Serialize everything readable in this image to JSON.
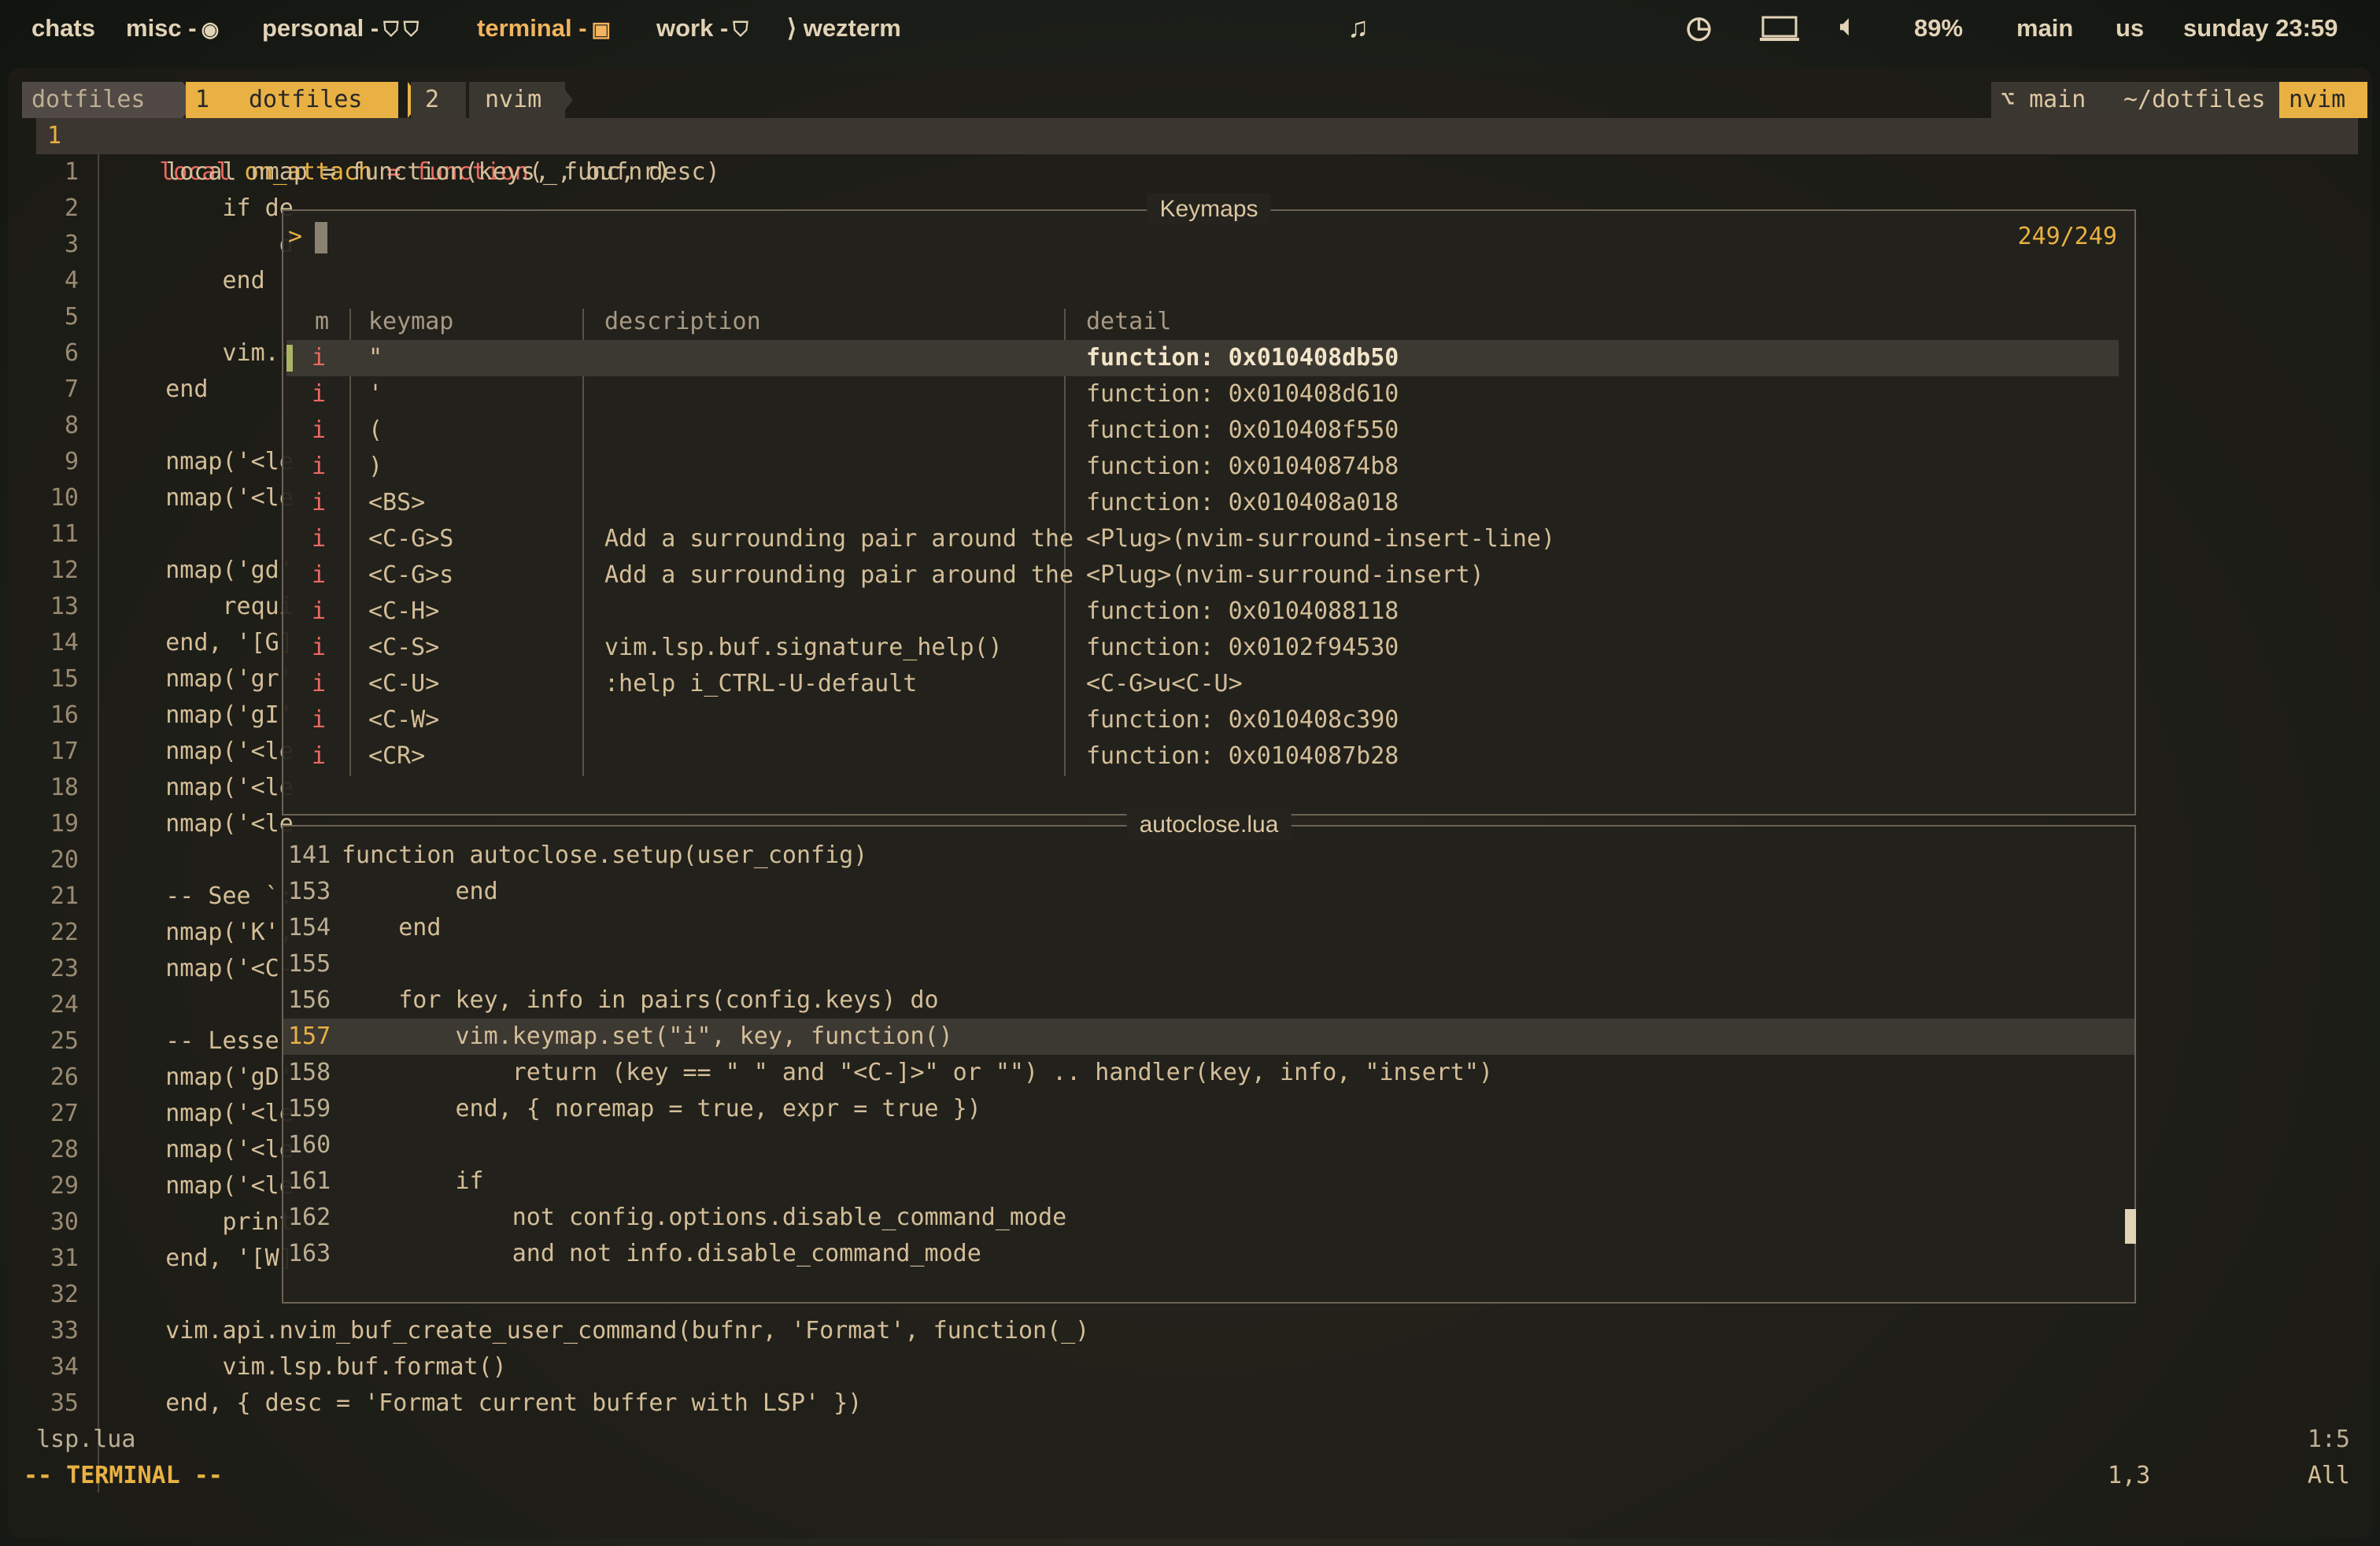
{
  "topbar": {
    "chats": "chats",
    "misc": "misc -",
    "personal": "personal -",
    "terminal": "terminal -",
    "work": "work -",
    "wezterm": "⟩ wezterm",
    "battery": "89%",
    "branch": "main",
    "lang": "us",
    "datetime": "sunday 23:59",
    "icons": [
      "music-note-icon",
      "clock-icon",
      "laptop-icon",
      "volume-icon"
    ]
  },
  "tabline": {
    "left": [
      {
        "label": "dotfiles"
      },
      {
        "label": "1"
      },
      {
        "label": "dotfiles"
      },
      {
        "label": "2"
      },
      {
        "label": "nvim"
      }
    ],
    "right": [
      {
        "label": "⌥ main"
      },
      {
        "label": "~/dotfiles"
      },
      {
        "label": "nvim"
      }
    ]
  },
  "first_line": {
    "num": "1",
    "text": "local on_attach = function(_, bufnr)"
  },
  "buffer_lines": [
    {
      "n": "1",
      "t": "    local nmap = function(keys, func, desc)"
    },
    {
      "n": "2",
      "t": "        if de"
    },
    {
      "n": "3",
      "t": "            d"
    },
    {
      "n": "4",
      "t": "        end"
    },
    {
      "n": "5",
      "t": ""
    },
    {
      "n": "6",
      "t": "        vim.k"
    },
    {
      "n": "7",
      "t": "    end"
    },
    {
      "n": "8",
      "t": ""
    },
    {
      "n": "9",
      "t": "    nmap('<le"
    },
    {
      "n": "10",
      "t": "    nmap('<le"
    },
    {
      "n": "11",
      "t": ""
    },
    {
      "n": "12",
      "t": "    nmap('gd'"
    },
    {
      "n": "13",
      "t": "        requi"
    },
    {
      "n": "14",
      "t": "    end, '[G]"
    },
    {
      "n": "15",
      "t": "    nmap('gr'"
    },
    {
      "n": "16",
      "t": "    nmap('gI'"
    },
    {
      "n": "17",
      "t": "    nmap('<le"
    },
    {
      "n": "18",
      "t": "    nmap('<le"
    },
    {
      "n": "19",
      "t": "    nmap('<le"
    },
    {
      "n": "20",
      "t": ""
    },
    {
      "n": "21",
      "t": "    -- See `:"
    },
    {
      "n": "22",
      "t": "    nmap('K',"
    },
    {
      "n": "23",
      "t": "    nmap('<C-"
    },
    {
      "n": "24",
      "t": ""
    },
    {
      "n": "25",
      "t": "    -- Lesser"
    },
    {
      "n": "26",
      "t": "    nmap('gD'"
    },
    {
      "n": "27",
      "t": "    nmap('<le"
    },
    {
      "n": "28",
      "t": "    nmap('<le"
    },
    {
      "n": "29",
      "t": "    nmap('<le"
    },
    {
      "n": "30",
      "t": "        print"
    },
    {
      "n": "31",
      "t": "    end, '[W]"
    },
    {
      "n": "32",
      "t": ""
    },
    {
      "n": "33",
      "t": "    vim.api.nvim_buf_create_user_command(bufnr, 'Format', function(_)"
    },
    {
      "n": "34",
      "t": "        vim.lsp.buf.format()"
    },
    {
      "n": "35",
      "t": "    end, { desc = 'Format current buffer with LSP' })"
    }
  ],
  "keymaps": {
    "title": "Keymaps",
    "prompt": ">",
    "count": "249/249",
    "headers": {
      "m": "m",
      "keymap": "keymap",
      "description": "description",
      "detail": "detail"
    },
    "rows": [
      {
        "m": "i",
        "keymap": "\"",
        "description": "",
        "detail": "function: 0x010408db50"
      },
      {
        "m": "i",
        "keymap": "'",
        "description": "",
        "detail": "function: 0x010408d610"
      },
      {
        "m": "i",
        "keymap": "(",
        "description": "",
        "detail": "function: 0x010408f550"
      },
      {
        "m": "i",
        "keymap": ")",
        "description": "",
        "detail": "function: 0x01040874b8"
      },
      {
        "m": "i",
        "keymap": "<BS>",
        "description": "",
        "detail": "function: 0x010408a018"
      },
      {
        "m": "i",
        "keymap": "<C-G>S",
        "description": "Add a surrounding pair around the",
        "detail": "<Plug>(nvim-surround-insert-line)"
      },
      {
        "m": "i",
        "keymap": "<C-G>s",
        "description": "Add a surrounding pair around the",
        "detail": "<Plug>(nvim-surround-insert)"
      },
      {
        "m": "i",
        "keymap": "<C-H>",
        "description": "",
        "detail": "function: 0x0104088118"
      },
      {
        "m": "i",
        "keymap": "<C-S>",
        "description": "vim.lsp.buf.signature_help()",
        "detail": "function: 0x0102f94530"
      },
      {
        "m": "i",
        "keymap": "<C-U>",
        "description": ":help i_CTRL-U-default",
        "detail": "<C-G>u<C-U>"
      },
      {
        "m": "i",
        "keymap": "<C-W>",
        "description": "",
        "detail": "function: 0x010408c390"
      },
      {
        "m": "i",
        "keymap": "<CR>",
        "description": "",
        "detail": "function: 0x0104087b28"
      }
    ]
  },
  "preview": {
    "title": "autoclose.lua",
    "lines": [
      {
        "n": "141",
        "t": "function autoclose.setup(user_config)"
      },
      {
        "n": "153",
        "t": "        end"
      },
      {
        "n": "154",
        "t": "    end"
      },
      {
        "n": "155",
        "t": ""
      },
      {
        "n": "156",
        "t": "    for key, info in pairs(config.keys) do"
      },
      {
        "n": "157",
        "t": "        vim.keymap.set(\"i\", key, function()"
      },
      {
        "n": "158",
        "t": "            return (key == \" \" and \"<C-]>\" or \"\") .. handler(key, info, \"insert\")"
      },
      {
        "n": "159",
        "t": "        end, { noremap = true, expr = true })"
      },
      {
        "n": "160",
        "t": ""
      },
      {
        "n": "161",
        "t": "        if"
      },
      {
        "n": "162",
        "t": "            not config.options.disable_command_mode"
      },
      {
        "n": "163",
        "t": "            and not info.disable_command_mode"
      }
    ]
  },
  "status": {
    "filename": "lsp.lua",
    "position": "1:5",
    "mode": "-- TERMINAL --",
    "cursor": "1,3",
    "scroll": "All"
  },
  "colors": {
    "accent": "#e9b143",
    "keyword": "#ea6962",
    "text": "#d4be98"
  }
}
